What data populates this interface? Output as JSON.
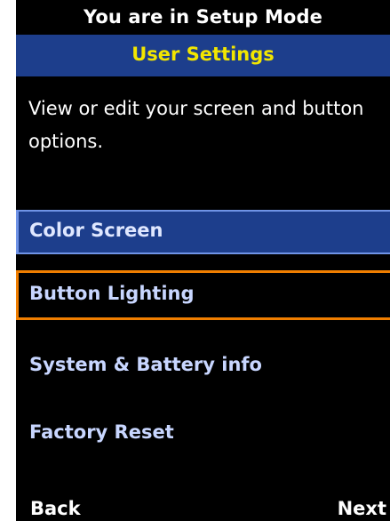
{
  "header": {
    "mode_text": "You are in Setup Mode",
    "title": "User Settings"
  },
  "description": "View or edit your screen and button options.",
  "menu": {
    "items": [
      {
        "label": "Color Screen",
        "state": "highlighted"
      },
      {
        "label": "Button Lighting",
        "state": "focused"
      },
      {
        "label": "System & Battery info",
        "state": "normal"
      },
      {
        "label": "Factory Reset",
        "state": "normal"
      }
    ]
  },
  "softkeys": {
    "left": "Back",
    "right": "Next"
  },
  "colors": {
    "background": "#000000",
    "title_bar": "#1d3e8c",
    "title_text": "#f2e600",
    "menu_text": "#c8d6ff",
    "focus_border": "#f07e00"
  }
}
